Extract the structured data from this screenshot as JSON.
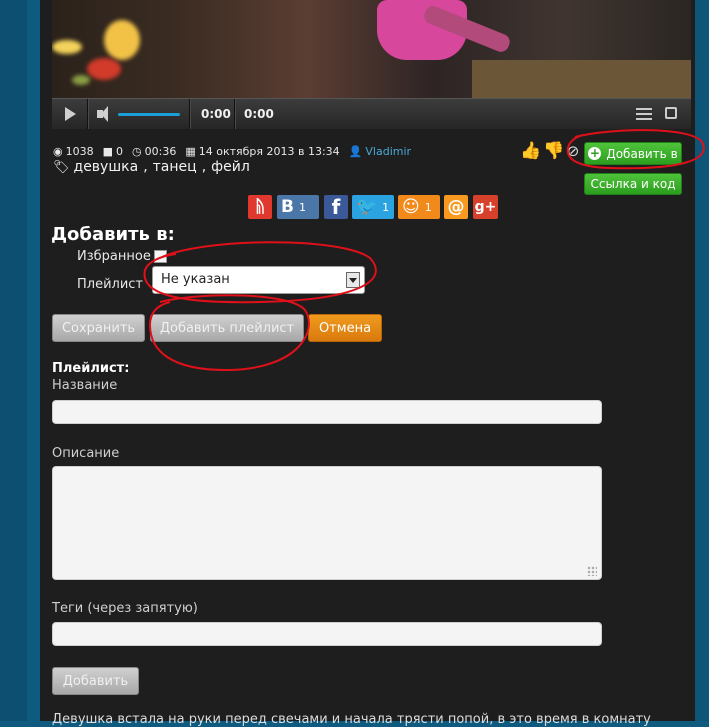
{
  "player": {
    "time_current": "0:00",
    "time_total": "0:00"
  },
  "meta": {
    "views": "1038",
    "comments": "0",
    "duration": "00:36",
    "date": "14 октября 2013 в 13:34",
    "author": "Vladimir"
  },
  "tags": [
    "девушка",
    "танец",
    "фейл"
  ],
  "actions": {
    "add_to_label": "Добавить в",
    "link_label": "Ссылка и код"
  },
  "social": {
    "vk_count": "1",
    "twitter_count": "1",
    "ok_count": "1"
  },
  "add_panel": {
    "title": "Добавить в:",
    "favorites_label": "Избранное",
    "playlist_label": "Плейлист",
    "playlist_selected": "Не указан",
    "save_label": "Сохранить",
    "add_playlist_label": "Добавить плейлист",
    "cancel_label": "Отмена"
  },
  "playlist_form": {
    "heading": "Плейлист:",
    "name_label": "Название",
    "description_label": "Описание",
    "tags_label": "Теги (через запятую)",
    "submit_label": "Добавить"
  },
  "description_text": "Девушка встала на руки перед свечами и начала трясти попой, в это время в комнату",
  "colors": {
    "panel": "#1e1e1e",
    "page_bg": "#0f5b80",
    "green_button": "#2c9e1f",
    "orange_button": "#e08a14",
    "annotation": "#e0101a"
  }
}
